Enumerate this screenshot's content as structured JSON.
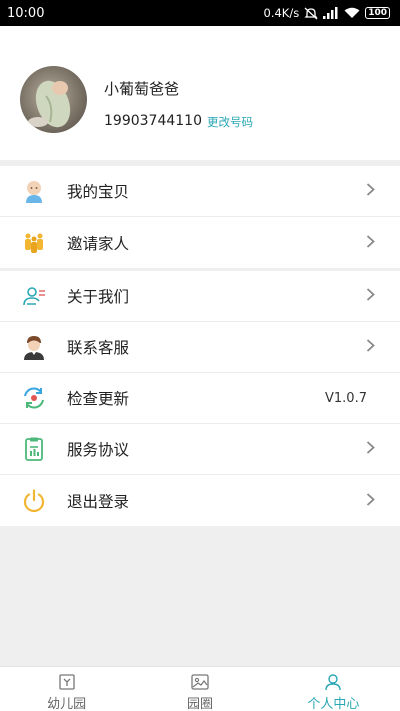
{
  "status_bar": {
    "time": "10:00",
    "network_speed": "0.4K/s",
    "battery": "100",
    "icons": [
      "mute-icon",
      "signal-icon",
      "wifi-icon",
      "battery-icon"
    ]
  },
  "profile": {
    "name": "小葡萄爸爸",
    "phone": "19903744110",
    "change_phone_label": "更改号码"
  },
  "menu_group_1": [
    {
      "label": "我的宝贝",
      "icon": "baby-icon"
    },
    {
      "label": "邀请家人",
      "icon": "family-icon"
    }
  ],
  "menu_group_2": [
    {
      "label": "关于我们",
      "icon": "about-icon"
    },
    {
      "label": "联系客服",
      "icon": "customer-service-icon"
    },
    {
      "label": "检查更新",
      "icon": "update-icon",
      "value": "V1.0.7"
    },
    {
      "label": "服务协议",
      "icon": "agreement-icon"
    },
    {
      "label": "退出登录",
      "icon": "power-icon"
    }
  ],
  "tabbar": {
    "tabs": [
      {
        "label": "幼儿园",
        "icon": "kindergarten-icon",
        "active": false
      },
      {
        "label": "园圈",
        "icon": "image-icon",
        "active": false
      },
      {
        "label": "个人中心",
        "icon": "person-icon",
        "active": true
      }
    ]
  },
  "colors": {
    "accent": "#2aa7b4",
    "background": "#efefef",
    "status_bar": "#000000"
  }
}
